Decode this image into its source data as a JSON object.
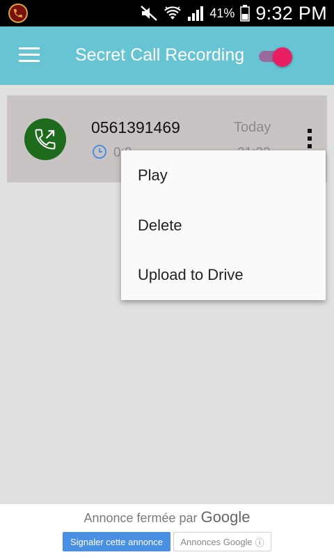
{
  "status_bar": {
    "battery_percent": "41%",
    "time": "9:32 PM",
    "icons": [
      "call-recording-notification-icon",
      "mute-icon",
      "wifi-icon",
      "signal-icon",
      "battery-icon"
    ]
  },
  "app_bar": {
    "title": "Secret Call Recording",
    "menu_icon": "hamburger-menu-icon",
    "recording_enabled": true,
    "colors": {
      "background": "#66c4d3",
      "toggle_thumb": "#e91e63",
      "toggle_track": "#9b6a9c"
    }
  },
  "call_list": [
    {
      "number": "0561391469",
      "date": "Today",
      "duration": "0:0",
      "time": "21:32",
      "direction": "outgoing",
      "icon": "outgoing-call-icon",
      "avatar_color": "#1e6b1e"
    }
  ],
  "context_menu": {
    "items": [
      "Play",
      "Delete",
      "Upload to Drive"
    ]
  },
  "ad_banner": {
    "closed_text": "Annonce fermée par",
    "google": "Google",
    "report_button": "Signaler cette annonce",
    "google_ads_button": "Annonces Google",
    "info_icon": "ⓘ",
    "colors": {
      "report_button": "#4a90e2"
    }
  }
}
